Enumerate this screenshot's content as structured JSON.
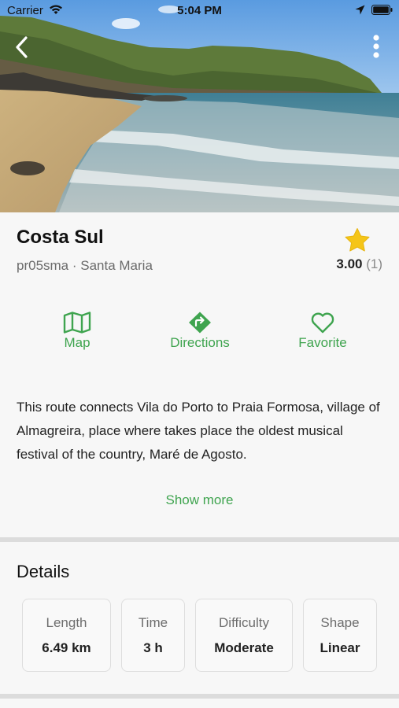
{
  "status_bar": {
    "carrier": "Carrier",
    "time": "5:04 PM"
  },
  "hero": {
    "back_icon": "chevron-left-icon",
    "more_icon": "vertical-ellipsis-icon"
  },
  "route": {
    "title": "Costa Sul",
    "subtitle": "pr05sma · Santa Maria",
    "rating_value": "3.00",
    "rating_count": "(1)",
    "rating_icon": "star-icon",
    "rating_color": "#f5c518"
  },
  "actions": [
    {
      "label": "Map",
      "icon": "map-icon"
    },
    {
      "label": "Directions",
      "icon": "directions-icon"
    },
    {
      "label": "Favorite",
      "icon": "heart-icon"
    }
  ],
  "accent_color": "#3fa44f",
  "description": "This route connects Vila do Porto to Praia Formosa, village of Almagreira, place where takes place the oldest musical festival of the country, Maré de Agosto.",
  "show_more_label": "Show more",
  "details": {
    "title": "Details",
    "items": [
      {
        "label": "Length",
        "value": "6.49 km"
      },
      {
        "label": "Time",
        "value": "3 h"
      },
      {
        "label": "Difficulty",
        "value": "Moderate"
      },
      {
        "label": "Shape",
        "value": "Linear"
      }
    ]
  }
}
